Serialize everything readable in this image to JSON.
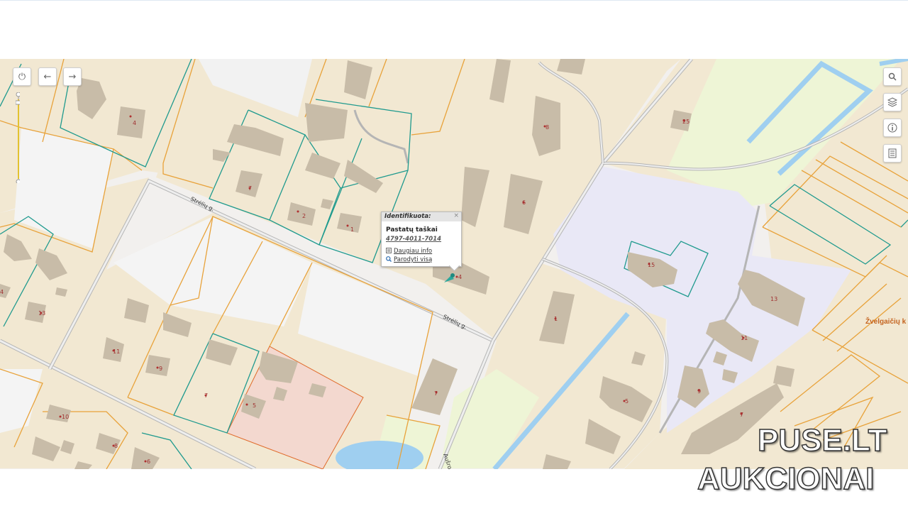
{
  "map": {
    "street_labels": [
      "Strėlių g.",
      "Strėlių g.",
      "Aušros g."
    ],
    "place_label": "Žvelgaičių k",
    "building_numbers": [
      "4",
      "8",
      "25",
      "7",
      "2",
      "1",
      "6",
      "4",
      "15",
      "13",
      "11",
      "13",
      "11",
      "9",
      "7",
      "10",
      "8",
      "6",
      "5",
      "7",
      "1",
      "5",
      "9",
      "7",
      "4"
    ]
  },
  "controls": {
    "power": "power-icon",
    "back": "arrow-left-icon",
    "forward": "arrow-right-icon",
    "search": "search-icon",
    "layers": "layers-icon",
    "info": "info-icon",
    "legend": "document-icon"
  },
  "popup": {
    "header": "Identifikuota:",
    "close": "×",
    "layer_title": "Pastatų taškai",
    "object_id": "4797-4011-7014",
    "more_info": "Daugiau info",
    "show_all": "Parodyti visą"
  },
  "watermark": {
    "line1": "PUSE.LT",
    "line2": "AUKCIONAI"
  },
  "colors": {
    "parcel_orange": "#e8a23a",
    "parcel_teal": "#1f9a8e",
    "built_area": "#f2e8d2",
    "building": "#c8bca8",
    "water": "#9fcff0",
    "green": "#eef5d6",
    "institution": "#e9e8f6",
    "road": "#b9b9b9"
  }
}
